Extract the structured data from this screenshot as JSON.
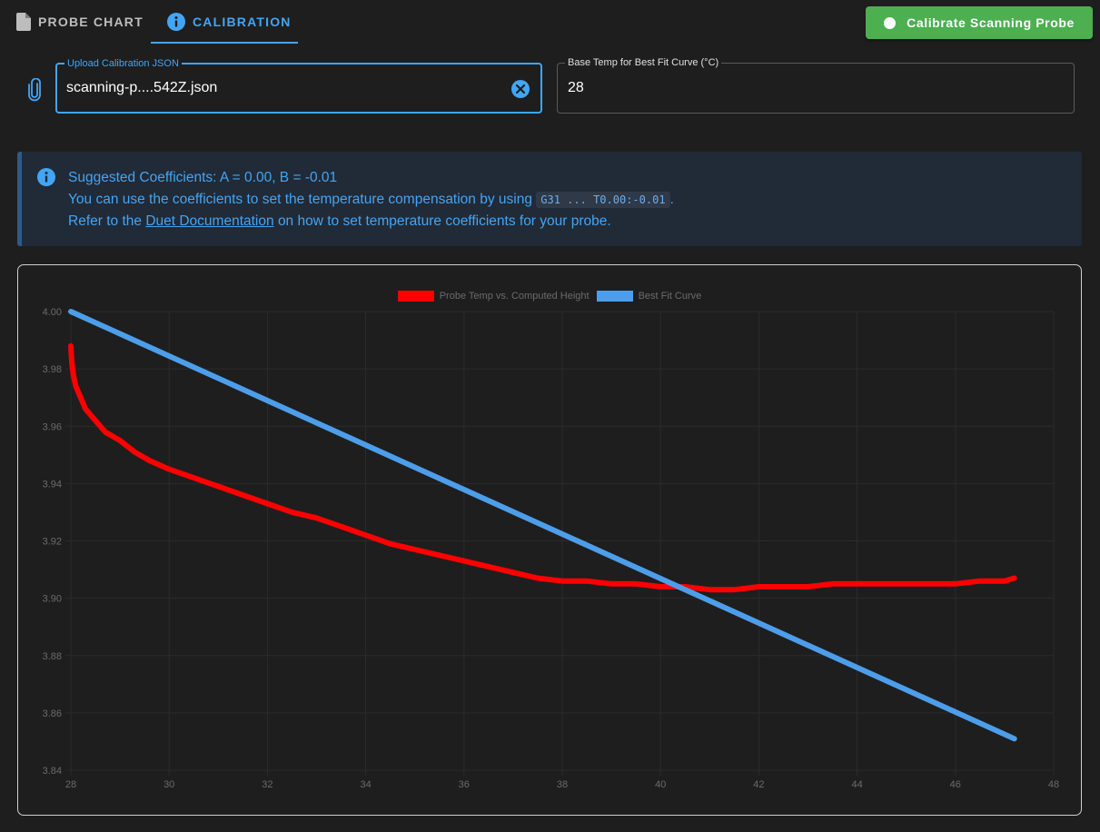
{
  "tabs": [
    {
      "label": "PROBE CHART",
      "icon": "file-icon"
    },
    {
      "label": "CALIBRATION",
      "icon": "info-icon"
    }
  ],
  "calibrate_button": {
    "label": "Calibrate Scanning Probe"
  },
  "upload": {
    "legend": "Upload Calibration JSON",
    "value": "scanning-p....542Z.json"
  },
  "base_temp": {
    "legend": "Base Temp for Best Fit Curve (°C)",
    "value": "28"
  },
  "alert": {
    "line1": "Suggested Coefficients: A = 0.00, B = -0.01",
    "line2_pre": "You can use the coefficients to set the temperature compensation by using",
    "line2_code": "G31 ... T0.00:-0.01",
    "line2_post": ".",
    "line3_pre": "Refer to the",
    "line3_link": "Duet Documentation",
    "line3_post": "on how to set temperature coefficients for your probe."
  },
  "colors": {
    "accent": "#42a5f5",
    "button": "#4caf50",
    "probe_series": "#ff0000",
    "fit_series": "#4d9eea"
  },
  "chart_data": {
    "type": "line",
    "legend_position": "top-center",
    "grid": true,
    "xlim": [
      28,
      48
    ],
    "ylim": [
      3.84,
      4.0
    ],
    "x_ticks": [
      "28",
      "30",
      "32",
      "34",
      "36",
      "38",
      "40",
      "42",
      "44",
      "46",
      "48"
    ],
    "y_ticks": [
      "4.00",
      "3.98",
      "3.96",
      "3.94",
      "3.92",
      "3.90",
      "3.88",
      "3.86",
      "3.84"
    ],
    "series": [
      {
        "name": "Probe Temp vs. Computed Height",
        "x": [
          28.0,
          28.02,
          28.05,
          28.1,
          28.2,
          28.3,
          28.5,
          28.7,
          29.0,
          29.3,
          29.6,
          30.0,
          30.5,
          31.0,
          31.5,
          32.0,
          32.5,
          33.0,
          33.5,
          34.0,
          34.5,
          35.0,
          35.5,
          36.0,
          36.5,
          37.0,
          37.5,
          38.0,
          38.5,
          39.0,
          39.5,
          40.0,
          40.5,
          41.0,
          41.5,
          42.0,
          42.5,
          43.0,
          43.5,
          44.0,
          44.5,
          45.0,
          45.5,
          46.0,
          46.5,
          47.0,
          47.2
        ],
        "y": [
          3.988,
          3.982,
          3.978,
          3.974,
          3.97,
          3.966,
          3.962,
          3.958,
          3.955,
          3.951,
          3.948,
          3.945,
          3.942,
          3.939,
          3.936,
          3.933,
          3.93,
          3.928,
          3.925,
          3.922,
          3.919,
          3.917,
          3.915,
          3.913,
          3.911,
          3.909,
          3.907,
          3.906,
          3.906,
          3.905,
          3.905,
          3.904,
          3.904,
          3.903,
          3.903,
          3.904,
          3.904,
          3.904,
          3.905,
          3.905,
          3.905,
          3.905,
          3.905,
          3.905,
          3.906,
          3.906,
          3.907
        ]
      },
      {
        "name": "Best Fit Curve",
        "x": [
          28.0,
          47.2
        ],
        "y": [
          4.0,
          3.851
        ]
      }
    ]
  }
}
